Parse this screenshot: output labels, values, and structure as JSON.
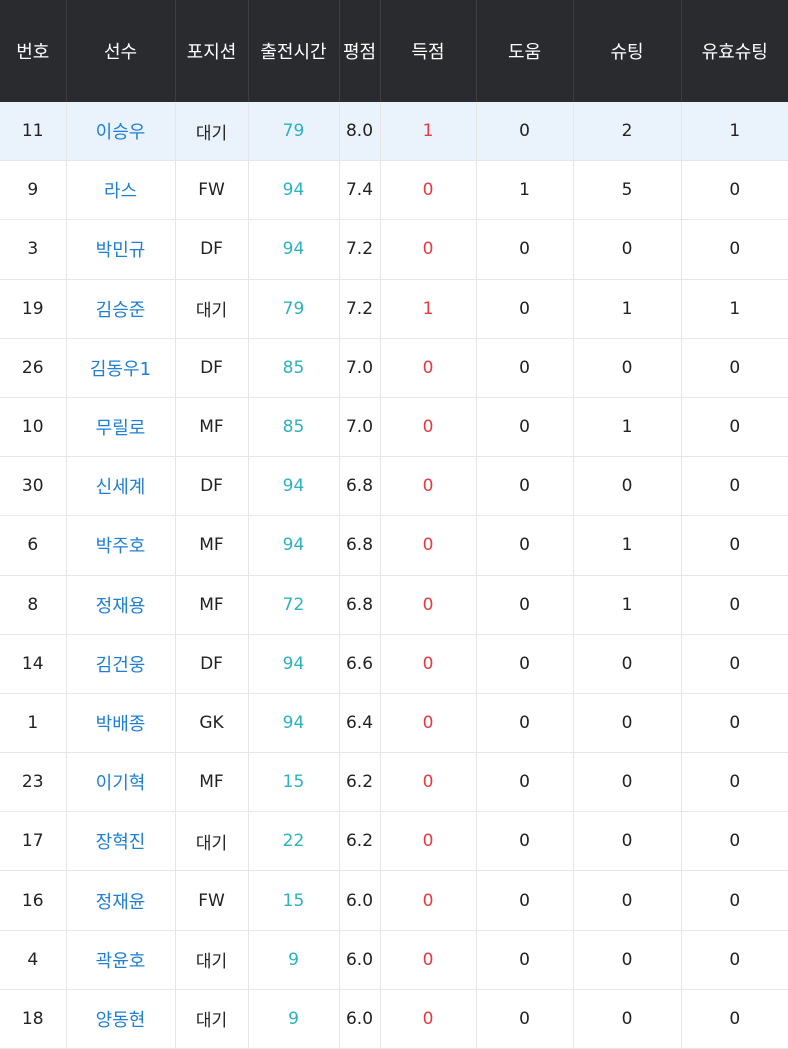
{
  "header": {
    "number": "번호",
    "player": "선수",
    "position": "포지션",
    "minutes": "출전시간",
    "rating": "평점",
    "goals": "득점",
    "assists": "도움",
    "shots": "슈팅",
    "shots_on_target": "유효슈팅"
  },
  "colors": {
    "header_bg": "#2a2b2e",
    "name": "#1f7fd4",
    "minutes": "#2ab3be",
    "goals": "#e8393f",
    "highlight_row": "#eaf3fc"
  },
  "rows": [
    {
      "number": "11",
      "player": "이승우",
      "position": "대기",
      "minutes": "79",
      "rating": "8.0",
      "goals": "1",
      "assists": "0",
      "shots": "2",
      "shots_on_target": "1"
    },
    {
      "number": "9",
      "player": "라스",
      "position": "FW",
      "minutes": "94",
      "rating": "7.4",
      "goals": "0",
      "assists": "1",
      "shots": "5",
      "shots_on_target": "0"
    },
    {
      "number": "3",
      "player": "박민규",
      "position": "DF",
      "minutes": "94",
      "rating": "7.2",
      "goals": "0",
      "assists": "0",
      "shots": "0",
      "shots_on_target": "0"
    },
    {
      "number": "19",
      "player": "김승준",
      "position": "대기",
      "minutes": "79",
      "rating": "7.2",
      "goals": "1",
      "assists": "0",
      "shots": "1",
      "shots_on_target": "1"
    },
    {
      "number": "26",
      "player": "김동우1",
      "position": "DF",
      "minutes": "85",
      "rating": "7.0",
      "goals": "0",
      "assists": "0",
      "shots": "0",
      "shots_on_target": "0"
    },
    {
      "number": "10",
      "player": "무릴로",
      "position": "MF",
      "minutes": "85",
      "rating": "7.0",
      "goals": "0",
      "assists": "0",
      "shots": "1",
      "shots_on_target": "0"
    },
    {
      "number": "30",
      "player": "신세계",
      "position": "DF",
      "minutes": "94",
      "rating": "6.8",
      "goals": "0",
      "assists": "0",
      "shots": "0",
      "shots_on_target": "0"
    },
    {
      "number": "6",
      "player": "박주호",
      "position": "MF",
      "minutes": "94",
      "rating": "6.8",
      "goals": "0",
      "assists": "0",
      "shots": "1",
      "shots_on_target": "0"
    },
    {
      "number": "8",
      "player": "정재용",
      "position": "MF",
      "minutes": "72",
      "rating": "6.8",
      "goals": "0",
      "assists": "0",
      "shots": "1",
      "shots_on_target": "0"
    },
    {
      "number": "14",
      "player": "김건웅",
      "position": "DF",
      "minutes": "94",
      "rating": "6.6",
      "goals": "0",
      "assists": "0",
      "shots": "0",
      "shots_on_target": "0"
    },
    {
      "number": "1",
      "player": "박배종",
      "position": "GK",
      "minutes": "94",
      "rating": "6.4",
      "goals": "0",
      "assists": "0",
      "shots": "0",
      "shots_on_target": "0"
    },
    {
      "number": "23",
      "player": "이기혁",
      "position": "MF",
      "minutes": "15",
      "rating": "6.2",
      "goals": "0",
      "assists": "0",
      "shots": "0",
      "shots_on_target": "0"
    },
    {
      "number": "17",
      "player": "장혁진",
      "position": "대기",
      "minutes": "22",
      "rating": "6.2",
      "goals": "0",
      "assists": "0",
      "shots": "0",
      "shots_on_target": "0"
    },
    {
      "number": "16",
      "player": "정재윤",
      "position": "FW",
      "minutes": "15",
      "rating": "6.0",
      "goals": "0",
      "assists": "0",
      "shots": "0",
      "shots_on_target": "0"
    },
    {
      "number": "4",
      "player": "곽윤호",
      "position": "대기",
      "minutes": "9",
      "rating": "6.0",
      "goals": "0",
      "assists": "0",
      "shots": "0",
      "shots_on_target": "0"
    },
    {
      "number": "18",
      "player": "양동현",
      "position": "대기",
      "minutes": "9",
      "rating": "6.0",
      "goals": "0",
      "assists": "0",
      "shots": "0",
      "shots_on_target": "0"
    }
  ]
}
